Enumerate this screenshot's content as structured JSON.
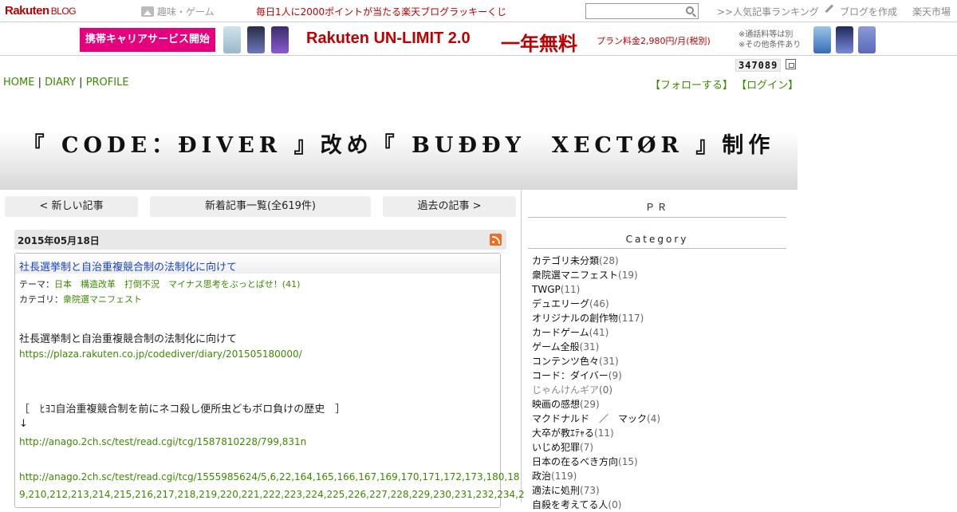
{
  "topbar": {
    "logo": "Rakuten",
    "logo_sub": "BLOG",
    "genre_label": "趣味・ゲーム",
    "lucky_text": "毎日1人に2000ポイントが当たる楽天ブログラッキーくじ",
    "search_placeholder": "",
    "ranking": ">>人気記事ランキング",
    "create": "ブログを作成",
    "ichiba": "楽天市場"
  },
  "banner": {
    "carrier": "携帯キャリアサービス開始",
    "unlimit": "Rakuten UN-LIMIT 2.0",
    "free": "一年無料",
    "price": "プラン料金2,980円/月(税別)",
    "note1": "※通話料等は別",
    "note2": "※その他条件あり"
  },
  "counter": "347089",
  "nav": {
    "home": "HOME",
    "diary": "DIARY",
    "profile": "PROFILE",
    "sep": "|",
    "follow": "【フォローする】",
    "login": "【ログイン】"
  },
  "blog_title": "『 CODE：ĐIVER 』改め『 BUĐĐY　XECTØR 』制作",
  "pager": {
    "newer": "< 新しい記事",
    "list": "新着記事一覧(全619件)",
    "older": "過去の記事 >"
  },
  "post": {
    "date": "2015年05月18日",
    "title": "社長選挙制と自治重複競合制の法制化に向けて",
    "theme_label": "テーマ：",
    "theme_value": "日本　構造改革　打倒不況　マイナス思考をぶっとばせ！(41)",
    "category_label": "カテゴリ：",
    "category_value": "衆院選マニフェスト",
    "line1": "社長選挙制と自治重複競合制の法制化に向けて",
    "link1": "https://plaza.rakuten.co.jp/codediver/diary/201505180000/",
    "line2": "［　ﾋﾖｺ自治重複競合制を前にネコ殺し便所虫どもボロ負けの歴史　］",
    "arrow": "↓",
    "link2": "http://anago.2ch.sc/test/read.cgi/tcg/1587810228/799,831n",
    "link3a": "http://anago.2ch.sc/test/read.cgi/tcg/1555985624/5,6,22,164,165,166,167,169,170,171,172,173,180,18",
    "link3b": "9,210,212,213,214,215,216,217,218,219,220,221,222,223,224,225,226,227,228,229,230,231,232,234,2"
  },
  "sidebar": {
    "pr": "ＰＲ",
    "category": "Category",
    "categories": [
      {
        "name": "カテゴリ未分類",
        "count": "(28)"
      },
      {
        "name": "衆院選マニフェスト",
        "count": "(19)"
      },
      {
        "name": "TWGP",
        "count": "(11)"
      },
      {
        "name": "デュエリーグ",
        "count": "(46)"
      },
      {
        "name": "オリジナルの創作物",
        "count": "(117)"
      },
      {
        "name": "カードゲーム",
        "count": "(41)"
      },
      {
        "name": "ゲーム全般",
        "count": "(31)"
      },
      {
        "name": "コンテンツ色々",
        "count": "(31)"
      },
      {
        "name": "コード：ダイバー",
        "count": "(9)"
      },
      {
        "name": "じゃんけんギア",
        "count": "(0)"
      },
      {
        "name": "映画の感想",
        "count": "(29)"
      },
      {
        "name": "マクドナルド　／　マック",
        "count": "(4)"
      },
      {
        "name": "大卒が教ｴﾃｬる",
        "count": "(11)"
      },
      {
        "name": "いじめ犯罪",
        "count": "(7)"
      },
      {
        "name": "日本の在るべき方向",
        "count": "(15)"
      },
      {
        "name": "政治",
        "count": "(119)"
      },
      {
        "name": "適法に処刑",
        "count": "(73)"
      },
      {
        "name": "自殺を考えてる人",
        "count": "(0)"
      }
    ]
  }
}
